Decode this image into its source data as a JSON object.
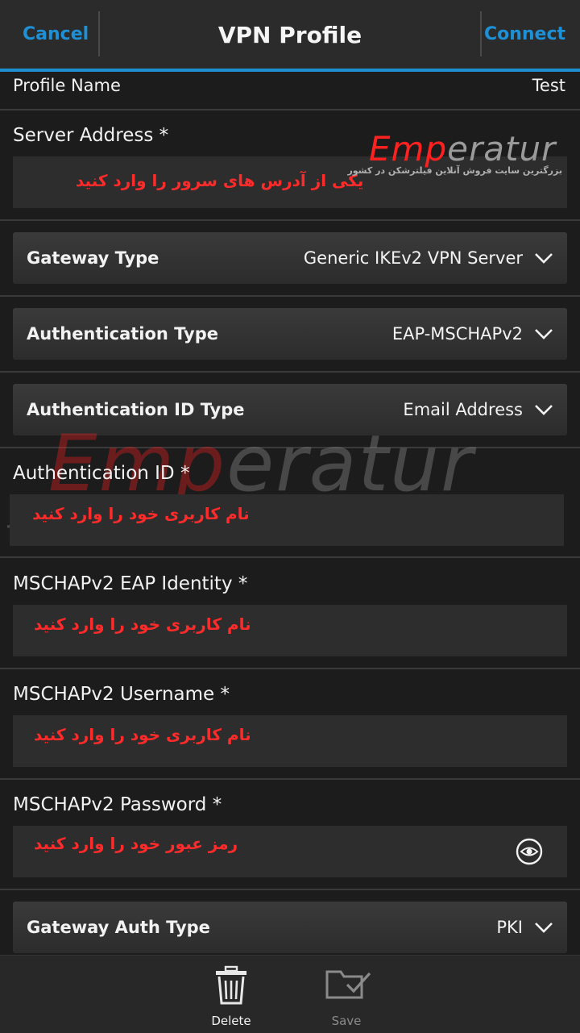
{
  "header": {
    "cancel_label": "Cancel",
    "title": "VPN Profile",
    "connect_label": "Connect"
  },
  "profile_name": {
    "label": "Profile Name",
    "value": "Test"
  },
  "server_address": {
    "label": "Server Address *",
    "hint": "یکی از آدرس های سرور را وارد کنید"
  },
  "gateway_type": {
    "label": "Gateway Type",
    "value": "Generic IKEv2 VPN Server"
  },
  "auth_type": {
    "label": "Authentication Type",
    "value": "EAP-MSCHAPv2"
  },
  "auth_id_type": {
    "label": "Authentication ID Type",
    "value": "Email Address"
  },
  "auth_id": {
    "label": "Authentication ID *",
    "hint": "نام کاربری خود را وارد کنید"
  },
  "eap_identity": {
    "label": "MSCHAPv2 EAP Identity *",
    "hint": "نام کاربری خود را وارد کنید"
  },
  "username": {
    "label": "MSCHAPv2 Username *",
    "hint": "نام کاربری خود را وارد کنید"
  },
  "password": {
    "label": "MSCHAPv2 Password *",
    "hint": "رمز عبور خود را وارد کنید"
  },
  "gateway_auth_type": {
    "label": "Gateway Auth Type",
    "value": "PKI"
  },
  "watermark": {
    "logo_a": "Emp",
    "logo_b": "eratur",
    "tagline": "بزرگترین سایت فروش آنلاین فیلترشکن در کشور"
  },
  "footer": {
    "delete_label": "Delete",
    "save_label": "Save"
  },
  "icons": {
    "chevron": "chevron-down-icon",
    "eye": "eye-icon",
    "delete": "trash-icon",
    "save": "folder-check-icon"
  },
  "colors": {
    "accent": "#1e8fd0",
    "hint_red": "#ff2b2b",
    "background": "#1c1c1c"
  }
}
